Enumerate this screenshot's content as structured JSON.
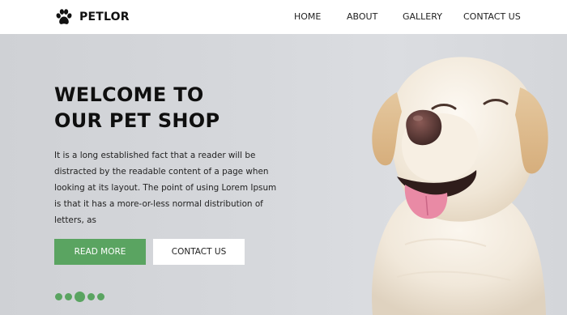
{
  "header": {
    "brand": {
      "name": "PETLOR",
      "icon": "paw-icon"
    },
    "nav": [
      {
        "label": "HOME"
      },
      {
        "label": "ABOUT"
      },
      {
        "label": "GALLERY"
      },
      {
        "label": "CONTACT US"
      }
    ]
  },
  "hero": {
    "headline_line1": "WELCOME TO",
    "headline_line2": "OUR PET SHOP",
    "description": "It is a long established fact that a reader will be distracted by the readable content of a page when looking at its layout. The point of using Lorem Ipsum is that it has a more-or-less normal distribution of letters, as",
    "primary_button": "READ MORE",
    "secondary_button": "CONTACT US",
    "carousel": {
      "slides": 5,
      "active_index": 2
    },
    "image": "labrador-dog-photo"
  },
  "colors": {
    "accent": "#5aa461",
    "header_bg": "#ffffff",
    "hero_bg": "#d2d4d8",
    "text": "#111111"
  }
}
